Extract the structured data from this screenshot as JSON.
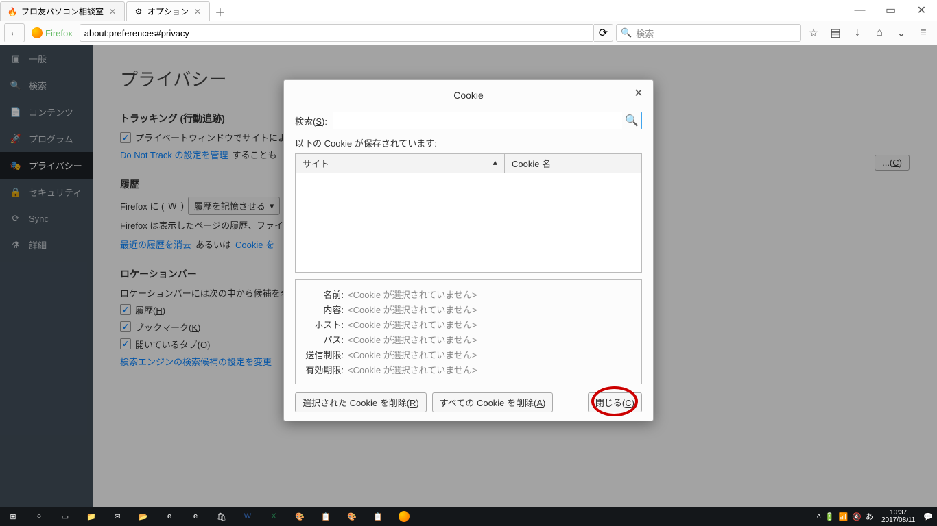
{
  "tabs": [
    {
      "title": "プロ友パソコン相談室"
    },
    {
      "title": "オプション"
    }
  ],
  "url": "about:preferences#privacy",
  "identity": "Firefox",
  "search_placeholder": "検索",
  "sidebar": {
    "items": [
      {
        "label": "一般"
      },
      {
        "label": "検索"
      },
      {
        "label": "コンテンツ"
      },
      {
        "label": "プログラム"
      },
      {
        "label": "プライバシー"
      },
      {
        "label": "セキュリティ"
      },
      {
        "label": "Sync"
      },
      {
        "label": "詳細"
      }
    ]
  },
  "page": {
    "title": "プライバシー",
    "tracking_heading": "トラッキング (行動追跡)",
    "tracking_checkbox": "プライベートウィンドウでサイトによる",
    "dnt_link": "Do Not Track の設定を管理",
    "dnt_rest": "することも",
    "history_heading": "履歴",
    "history_prefix": "Firefox に (",
    "history_key": "W",
    "history_select": "履歴を記憶させる",
    "history_desc": "Firefox は表示したページの履歴、ファイ                                                                                                                                                          存します。",
    "clear_history_link": "最近の履歴を消去",
    "clear_or": " あるいは ",
    "cookie_link": "Cookie を",
    "location_heading": "ロケーションバー",
    "location_desc": "ロケーションバーには次の中から候補を表",
    "loc_history": "履歴(",
    "loc_history_key": "H",
    "loc_bookmark": "ブックマーク(",
    "loc_bookmark_key": "K",
    "loc_tabs": "開いているタブ(",
    "loc_tabs_key": "O",
    "search_engine_link": "検索エンジンの検索候補の設定を変更",
    "change_btn": "C"
  },
  "modal": {
    "title": "Cookie",
    "search_label": "検索(",
    "search_key": "S",
    "search_suffix": "):",
    "stored_note": "以下の Cookie が保存されています:",
    "col_site": "サイト",
    "col_cookie": "Cookie 名",
    "detail_labels": {
      "name": "名前:",
      "content": "内容:",
      "host": "ホスト:",
      "path": "パス:",
      "send": "送信制限:",
      "expires": "有効期限:"
    },
    "detail_placeholder": "<Cookie が選択されていません>",
    "btn_remove_selected": "選択された Cookie を削除(",
    "btn_remove_selected_key": "R",
    "btn_remove_all": "すべての Cookie を削除(",
    "btn_remove_all_key": "A",
    "btn_close": "閉じる(",
    "btn_close_key": "C"
  },
  "taskbar": {
    "ime": "あ",
    "time": "10:37",
    "date": "2017/08/11"
  }
}
